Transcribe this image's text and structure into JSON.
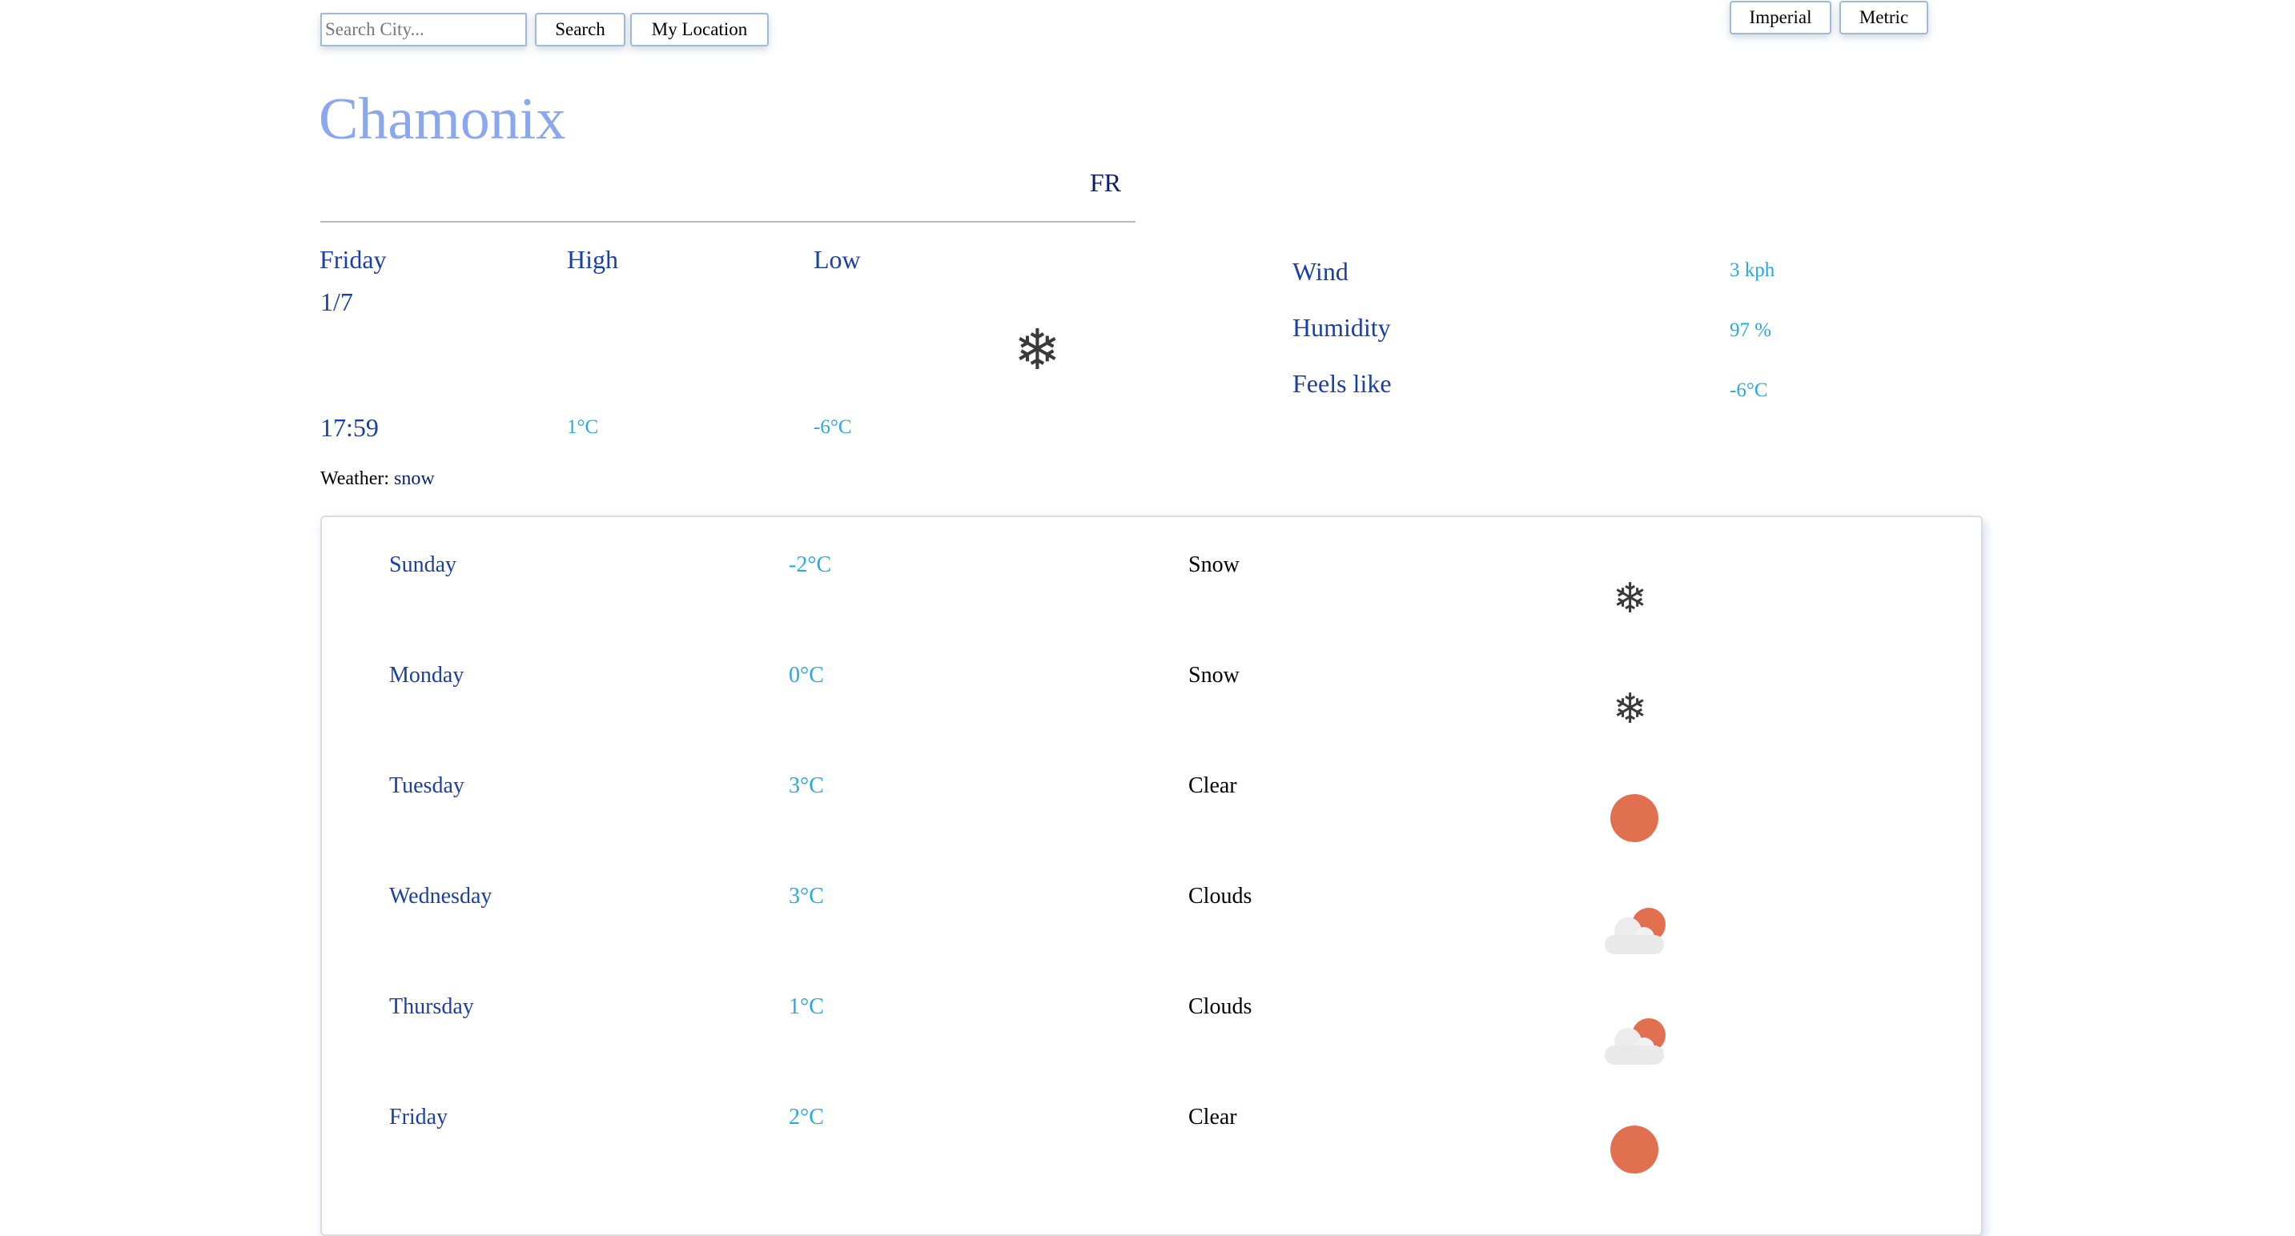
{
  "search": {
    "placeholder": "Search City...",
    "search_label": "Search",
    "location_label": "My Location"
  },
  "units": {
    "imperial_label": "Imperial",
    "metric_label": "Metric"
  },
  "current": {
    "city": "Chamonix",
    "country": "FR",
    "day": "Friday",
    "date": "1/7",
    "time": "17:59",
    "high_label": "High",
    "low_label": "Low",
    "high": "1°C",
    "low": "-6°C",
    "icon": "snowflake-icon",
    "weather_label": "Weather:",
    "weather": "snow"
  },
  "details": {
    "wind_label": "Wind",
    "wind": "3 kph",
    "humidity_label": "Humidity",
    "humidity": "97 %",
    "feels_label": "Feels like",
    "feels": "-6°C"
  },
  "forecast": [
    {
      "day": "Sunday",
      "temp": "-2°C",
      "condition": "Snow",
      "icon": "snowflake-icon"
    },
    {
      "day": "Monday",
      "temp": "0°C",
      "condition": "Snow",
      "icon": "snowflake-icon"
    },
    {
      "day": "Tuesday",
      "temp": "3°C",
      "condition": "Clear",
      "icon": "sun-icon"
    },
    {
      "day": "Wednesday",
      "temp": "3°C",
      "condition": "Clouds",
      "icon": "partly-cloudy-icon"
    },
    {
      "day": "Thursday",
      "temp": "1°C",
      "condition": "Clouds",
      "icon": "partly-cloudy-icon"
    },
    {
      "day": "Friday",
      "temp": "2°C",
      "condition": "Clear",
      "icon": "sun-icon"
    }
  ],
  "colors": {
    "city": "#8aa7f0",
    "label": "#1a3fa6",
    "value": "#2aa8e0",
    "sun": "#e07050"
  }
}
